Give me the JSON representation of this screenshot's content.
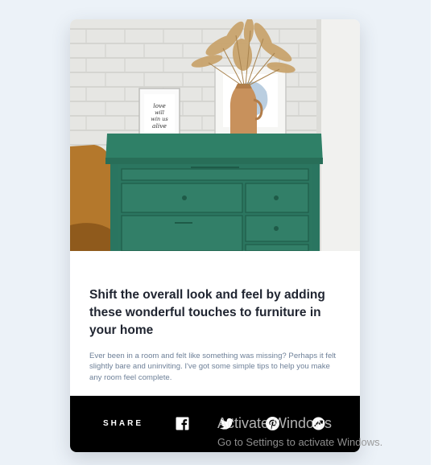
{
  "card": {
    "title": "Shift the overall look and feel by adding these wonderful touches to furniture in your home",
    "description": "Ever been in a room and felt like something was missing? Perhaps it felt slightly bare and uninviting. I've got some simple tips to help you make any room feel complete.",
    "frame_art_text": "love will win us alive"
  },
  "share": {
    "label": "SHARE",
    "icons": [
      "facebook-icon",
      "twitter-icon",
      "pinterest-icon",
      "share-icon"
    ]
  },
  "watermark": {
    "title": "Activate Windows",
    "subtitle": "Go to Settings to activate Windows."
  },
  "colors": {
    "page_bg": "#ECF2F8",
    "title_text": "#1F2430",
    "body_text": "#6E8098",
    "share_bar": "#000000",
    "dresser_green": "#2E7A63"
  }
}
